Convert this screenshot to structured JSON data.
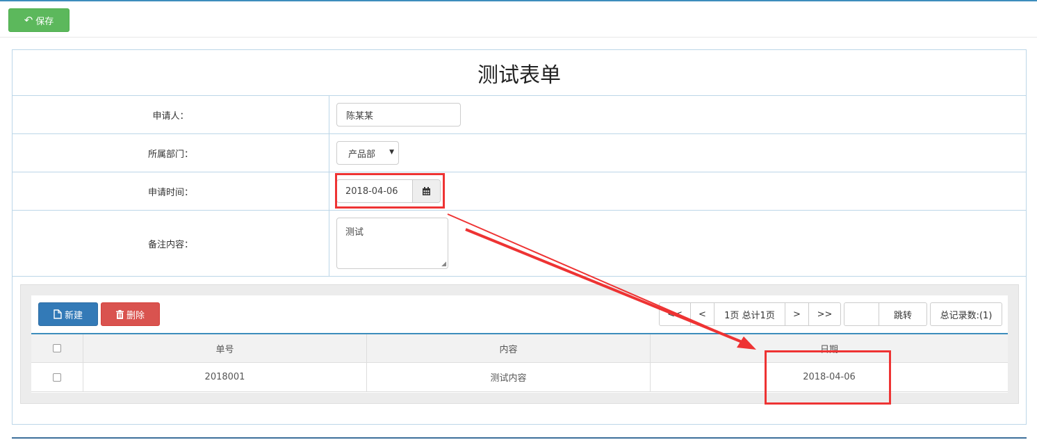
{
  "toolbar": {
    "save_label": "保存"
  },
  "form": {
    "title": "测试表单",
    "fields": {
      "applicant": {
        "label": "申请人：",
        "value": "陈某某"
      },
      "department": {
        "label": "所属部门：",
        "value": "产品部"
      },
      "apply_date": {
        "label": "申请时间：",
        "value": "2018-04-06"
      },
      "remark": {
        "label": "备注内容：",
        "value": "测试"
      }
    }
  },
  "grid": {
    "new_label": "新建",
    "delete_label": "删除",
    "pager": {
      "first": "<<",
      "prev": "<",
      "info": "1页 总计1页",
      "next": ">",
      "last": ">>"
    },
    "jump_label": "跳转",
    "total_label": "总记录数:(1)",
    "columns": [
      "单号",
      "内容",
      "日期"
    ],
    "rows": [
      {
        "no": "2018001",
        "content": "测试内容",
        "date": "2018-04-06"
      }
    ]
  },
  "annotation": {
    "color": "#e33333"
  }
}
